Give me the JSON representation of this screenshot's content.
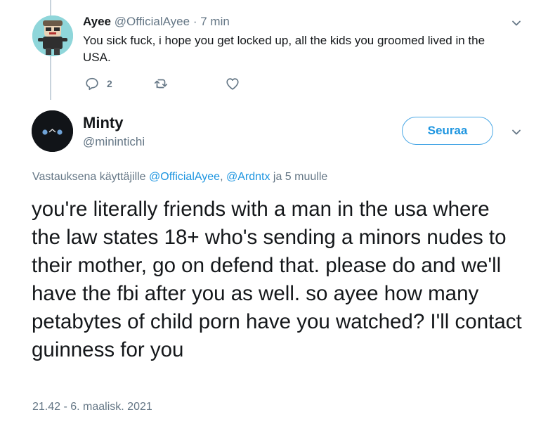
{
  "tweet1": {
    "name": "Ayee",
    "handle": "@OfficialAyee",
    "separator": "·",
    "time": "7 min",
    "text": "You sick fuck, i hope you get locked up, all the kids you groomed lived in the USA.",
    "reply_count": "2",
    "icons": {
      "reply": "reply-icon",
      "retweet": "retweet-icon",
      "like": "heart-icon",
      "more": "chevron-down-icon"
    }
  },
  "tweet2": {
    "name": "Minty",
    "handle": "@minintichi",
    "follow_label": "Seuraa",
    "reply_prefix": "Vastauksena käyttäjille",
    "reply_user1": "@OfficialAyee",
    "reply_comma": ",",
    "reply_user2": "@Ardntx",
    "reply_suffix": "ja 5 muulle",
    "text": "you're literally friends with a man in the usa where the law states 18+ who's sending a minors nudes to their mother, go on defend that. please do and we'll have the fbi after you as well. so ayee how many petabytes of child porn have you watched? I'll contact guinness for you",
    "timestamp": "21.42 - 6. maalisk. 2021"
  },
  "colors": {
    "accent": "#1d95e0",
    "secondary_text": "#657786",
    "primary_text": "#14171a",
    "thread_line": "#c8d3dc"
  }
}
